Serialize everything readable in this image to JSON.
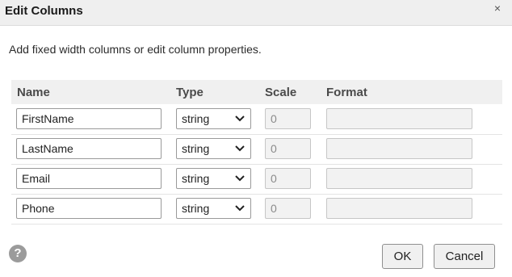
{
  "dialog": {
    "title": "Edit Columns",
    "close_glyph": "×",
    "description": "Add fixed width columns or edit column properties."
  },
  "table": {
    "headers": {
      "name": "Name",
      "type": "Type",
      "scale": "Scale",
      "format": "Format"
    },
    "rows": [
      {
        "name": "FirstName",
        "type": "string",
        "scale": "0",
        "format": ""
      },
      {
        "name": "LastName",
        "type": "string",
        "scale": "0",
        "format": ""
      },
      {
        "name": "Email",
        "type": "string",
        "scale": "0",
        "format": ""
      },
      {
        "name": "Phone",
        "type": "string",
        "scale": "0",
        "format": ""
      }
    ]
  },
  "footer": {
    "help_glyph": "?",
    "ok_label": "OK",
    "cancel_label": "Cancel"
  },
  "icons": {
    "close": "close-icon",
    "help": "help-icon",
    "dropdown": "chevron-down-icon"
  },
  "colors": {
    "titlebar_bg": "#efefef",
    "header_bg": "#f0f0f0",
    "disabled_bg": "#f2f2f2",
    "help_bg": "#9b9b9b"
  }
}
